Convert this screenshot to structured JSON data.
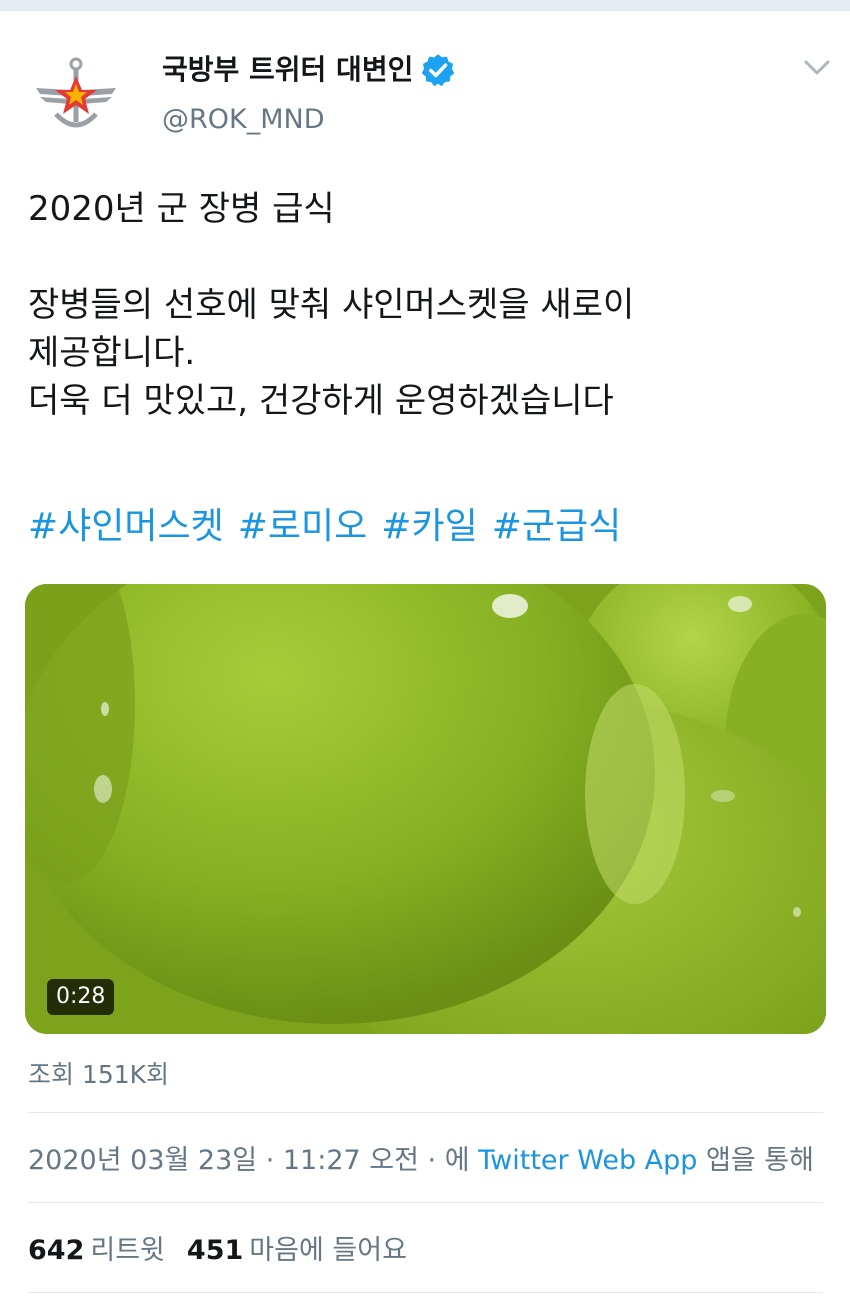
{
  "account": {
    "display_name": "국방부 트위터 대변인",
    "handle": "@ROK_MND",
    "verified": true,
    "avatar_icon": "ministry-emblem-icon"
  },
  "tweet": {
    "title_line": "2020년 군 장병 급식",
    "body_lines": [
      "장병들의 선호에 맞춰 샤인머스켓을 새로이",
      "제공합니다.",
      "더욱 더 맛있고, 건강하게 운영하겠습니다"
    ],
    "hashtags": [
      "#샤인머스켓",
      "#로미오",
      "#카일",
      "#군급식"
    ]
  },
  "media": {
    "duration": "0:28",
    "subject": "green shine muscat grapes video thumbnail"
  },
  "views": "조회 151K회",
  "meta": {
    "date": "2020년 03월 23일",
    "sep1": " · ",
    "time": "11:27 오전",
    "sep2": " · ",
    "prefix": "에 ",
    "source": "Twitter Web App",
    "suffix": " 앱을 통해"
  },
  "stats": {
    "retweets_count": "642",
    "retweets_label": "리트윗",
    "likes_count": "451",
    "likes_label": "마음에 들어요"
  },
  "colors": {
    "link": "#1b95e0",
    "secondary_text": "#657786",
    "primary_text": "#14171a",
    "verified": "#1da1f2",
    "grape_green": "#8ab526"
  }
}
